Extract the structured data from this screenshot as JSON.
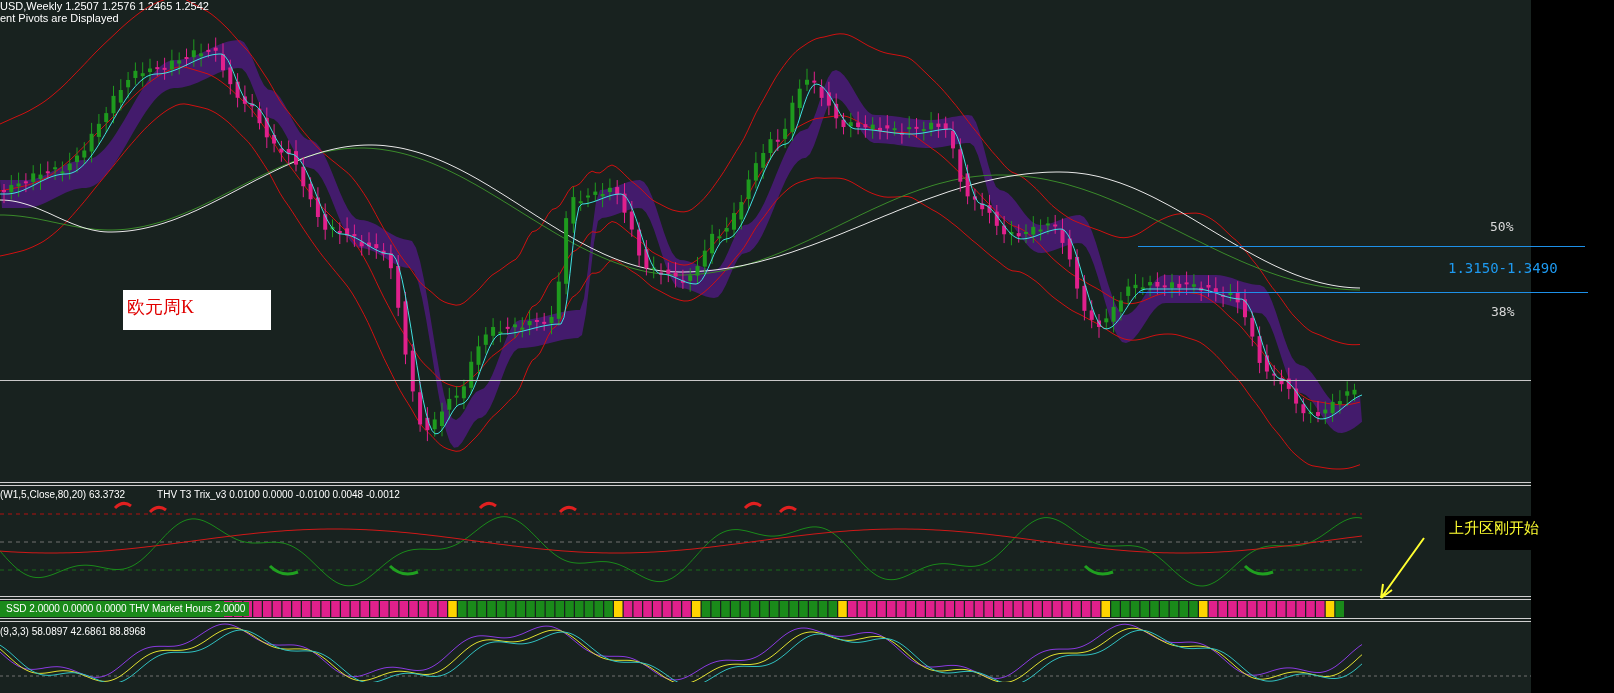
{
  "main_chart": {
    "header_lines": [
      "USD,Weekly  1.2507 1.2576 1.2465 1.2542",
      "ent Pivots are Displayed"
    ],
    "label_box": "欧元周K",
    "fib_labels": [
      "50%",
      "38%"
    ],
    "range_label": "1.3150-1.3490"
  },
  "trix_panel": {
    "header": "(W1,5,Close,80,20) 63.3732",
    "header_2": "THV T3 Trix_v3  0.0100 0.0000 -0.0100 0.0048 -0.0012"
  },
  "annotation": "上升区刚开始",
  "ssd_strip": {
    "header": "SSD 2.0000 0.0000 0.0000  THV Market Hours 2.0000"
  },
  "stoch_panel": {
    "header": "(9,3,3) 58.0897 42.6861 88.8968"
  }
}
